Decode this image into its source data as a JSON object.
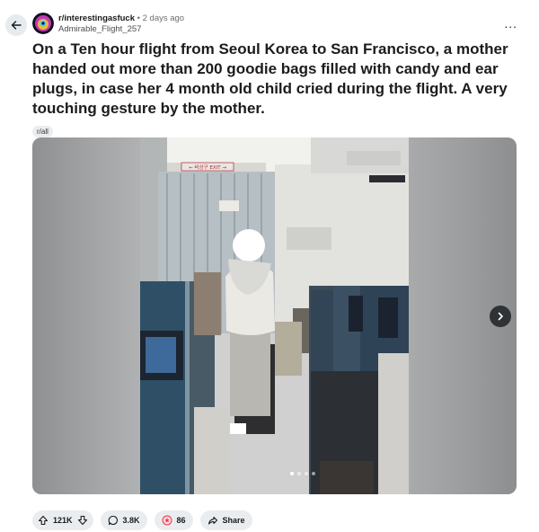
{
  "post": {
    "subreddit": "r/interestingasfuck",
    "separator": "•",
    "time_ago": "2 days ago",
    "author": "Admirable_Flight_257",
    "title": "On a Ten hour flight from Seoul Korea to San Francisco, a mother handed out more than 200 goodie bags filled with candy and ear plugs, in case her 4 month old child cried during the flight. A very touching gesture by the mother.",
    "flair": "r/all",
    "more_label": "..."
  },
  "gallery": {
    "image_count": 4,
    "active_index": 0,
    "exit_sign": "← 비상구 EXIT →"
  },
  "actions": {
    "votes": "121K",
    "comments": "3.8K",
    "awards": "86",
    "share": "Share"
  },
  "icons": {
    "back": "arrow-left-icon",
    "more": "ellipsis-icon",
    "upvote": "upvote-arrow-icon",
    "downvote": "downvote-arrow-icon",
    "comment": "comment-bubble-icon",
    "award": "award-icon",
    "share": "share-arrow-icon",
    "next": "chevron-right-icon"
  },
  "colors": {
    "background": "#ffffff",
    "pill": "#eaedef",
    "award_red": "#e8364c",
    "next_button": "#2f3336"
  }
}
